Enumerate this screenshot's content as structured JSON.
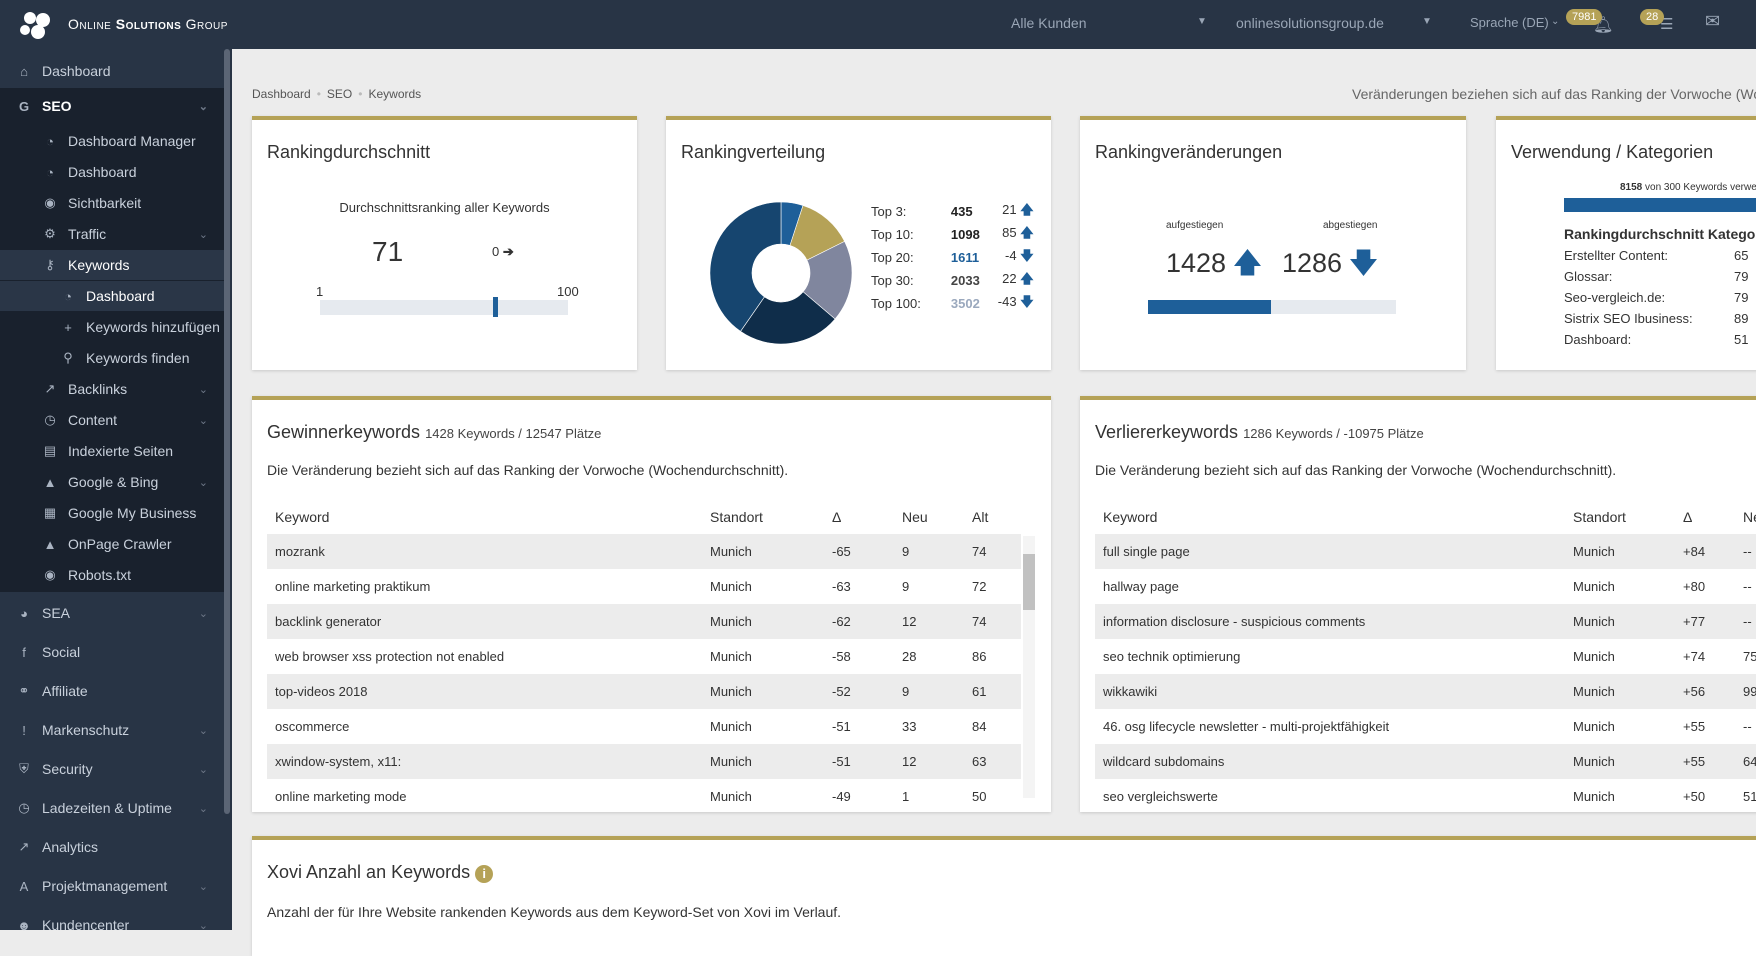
{
  "header": {
    "brand_light1": "Online ",
    "brand_bold": "Solutions",
    "brand_light2": " Group",
    "customer_select": "Alle Kunden",
    "domain_select": "onlinesolutionsgroup.de",
    "language": "Sprache (DE)",
    "notifications_count": "7981",
    "tasks_count": "28",
    "accent": "#b5a257"
  },
  "sidebar": {
    "items": [
      {
        "label": "Dashboard",
        "icon": "home-icon"
      },
      {
        "label": "SEO",
        "icon": "google-icon"
      },
      {
        "label": "Dashboard Manager",
        "icon": "dashboard-icon"
      },
      {
        "label": "Dashboard",
        "icon": "dashboard-icon"
      },
      {
        "label": "Sichtbarkeit",
        "icon": "eye-icon"
      },
      {
        "label": "Traffic",
        "icon": "gears-icon"
      },
      {
        "label": "Keywords",
        "icon": "key-icon"
      },
      {
        "label": "Dashboard",
        "icon": "dashboard-icon"
      },
      {
        "label": "Keywords hinzufügen",
        "icon": "plus-icon"
      },
      {
        "label": "Keywords finden",
        "icon": "search-icon"
      },
      {
        "label": "Backlinks",
        "icon": "external-link-icon"
      },
      {
        "label": "Content",
        "icon": "clock-icon"
      },
      {
        "label": "Indexierte Seiten",
        "icon": "file-icon"
      },
      {
        "label": "Google & Bing",
        "icon": "area-chart-icon"
      },
      {
        "label": "Google My Business",
        "icon": "store-icon"
      },
      {
        "label": "OnPage Crawler",
        "icon": "area-chart-icon"
      },
      {
        "label": "Robots.txt",
        "icon": "eye-icon"
      },
      {
        "label": "SEA",
        "icon": "pie-chart-icon"
      },
      {
        "label": "Social",
        "icon": "facebook-icon"
      },
      {
        "label": "Affiliate",
        "icon": "handshake-icon"
      },
      {
        "label": "Markenschutz",
        "icon": "exclamation-icon"
      },
      {
        "label": "Security",
        "icon": "shield-icon"
      },
      {
        "label": "Ladezeiten & Uptime",
        "icon": "clock-icon"
      },
      {
        "label": "Analytics",
        "icon": "line-chart-icon"
      },
      {
        "label": "Projektmanagement",
        "icon": "road-icon"
      },
      {
        "label": "Kundencenter",
        "icon": "users-icon"
      }
    ]
  },
  "breadcrumb": [
    "Dashboard",
    "SEO",
    "Keywords"
  ],
  "note": "Veränderungen beziehen sich auf das Ranking der Vorwoche (Wo",
  "avg": {
    "title": "Rankingdurchschnitt",
    "subtitle": "Durchschnittsranking aller Keywords",
    "value": "71",
    "change": "0",
    "min": "1",
    "max": "100",
    "position": 71
  },
  "dist": {
    "title": "Rankingverteilung",
    "rows": [
      {
        "label": "Top 3:",
        "value": "435",
        "change": "21",
        "dir": "up",
        "color": "#1e5f99"
      },
      {
        "label": "Top 10:",
        "value": "1098",
        "change": "85",
        "dir": "up",
        "color": "#b5a257"
      },
      {
        "label": "Top 20:",
        "value": "1611",
        "change": "-4",
        "dir": "down",
        "color": "#80869e"
      },
      {
        "label": "Top 30:",
        "value": "2033",
        "change": "22",
        "dir": "up",
        "color": "#0f2d4a"
      },
      {
        "label": "Top 100:",
        "value": "3502",
        "change": "-43",
        "dir": "down",
        "color": "#16456f"
      }
    ]
  },
  "changes": {
    "title": "Rankingveränderungen",
    "up_label": "aufgestiegen",
    "down_label": "abgestiegen",
    "up": "1428",
    "down": "1286"
  },
  "usage": {
    "title": "Verwendung / Kategorien",
    "used": "8158",
    "used_text": " von 300 Keywords verwe",
    "cat_title": "Rankingdurchschnitt Kategorie",
    "cats": [
      {
        "label": "Erstellter Content:",
        "value": "65"
      },
      {
        "label": "Glossar:",
        "value": "79"
      },
      {
        "label": "Seo-vergleich.de:",
        "value": "79"
      },
      {
        "label": "Sistrix SEO Ibusiness:",
        "value": "89"
      },
      {
        "label": "Dashboard:",
        "value": "51"
      }
    ]
  },
  "winners": {
    "title": "Gewinnerkeywords",
    "meta": "1428 Keywords / 12547 Plätze",
    "desc": "Die Veränderung bezieht sich auf das Ranking der Vorwoche (Wochendurchschnitt).",
    "cols": [
      "Keyword",
      "Standort",
      "Δ",
      "Neu",
      "Alt"
    ],
    "rows": [
      [
        "mozrank",
        "Munich",
        "-65",
        "9",
        "74"
      ],
      [
        "online marketing praktikum",
        "Munich",
        "-63",
        "9",
        "72"
      ],
      [
        "backlink generator",
        "Munich",
        "-62",
        "12",
        "74"
      ],
      [
        "web browser xss protection not enabled",
        "Munich",
        "-58",
        "28",
        "86"
      ],
      [
        "top-videos 2018",
        "Munich",
        "-52",
        "9",
        "61"
      ],
      [
        "oscommerce",
        "Munich",
        "-51",
        "33",
        "84"
      ],
      [
        "xwindow-system, x11:",
        "Munich",
        "-51",
        "12",
        "63"
      ],
      [
        "online marketing mode",
        "Munich",
        "-49",
        "1",
        "50"
      ]
    ]
  },
  "losers": {
    "title": "Verliererkeywords",
    "meta": "1286 Keywords / -10975 Plätze",
    "desc": "Die Veränderung bezieht sich auf das Ranking der Vorwoche (Wochendurchschnitt).",
    "cols": [
      "Keyword",
      "Standort",
      "Δ",
      "Ne"
    ],
    "rows": [
      [
        "full single page",
        "Munich",
        "+84",
        "--"
      ],
      [
        "hallway page",
        "Munich",
        "+80",
        "--"
      ],
      [
        "information disclosure - suspicious comments",
        "Munich",
        "+77",
        "--"
      ],
      [
        "seo technik optimierung",
        "Munich",
        "+74",
        "75"
      ],
      [
        "wikkawiki",
        "Munich",
        "+56",
        "99"
      ],
      [
        "46. osg lifecycle newsletter - multi-projektfähigkeit",
        "Munich",
        "+55",
        "--"
      ],
      [
        "wildcard subdomains",
        "Munich",
        "+55",
        "64"
      ],
      [
        "seo vergleichswerte",
        "Munich",
        "+50",
        "51"
      ]
    ]
  },
  "xovi": {
    "title": "Xovi Anzahl an Keywords",
    "desc": "Anzahl der für Ihre Website rankenden Keywords aus dem Keyword-Set von Xovi im Verlauf."
  }
}
